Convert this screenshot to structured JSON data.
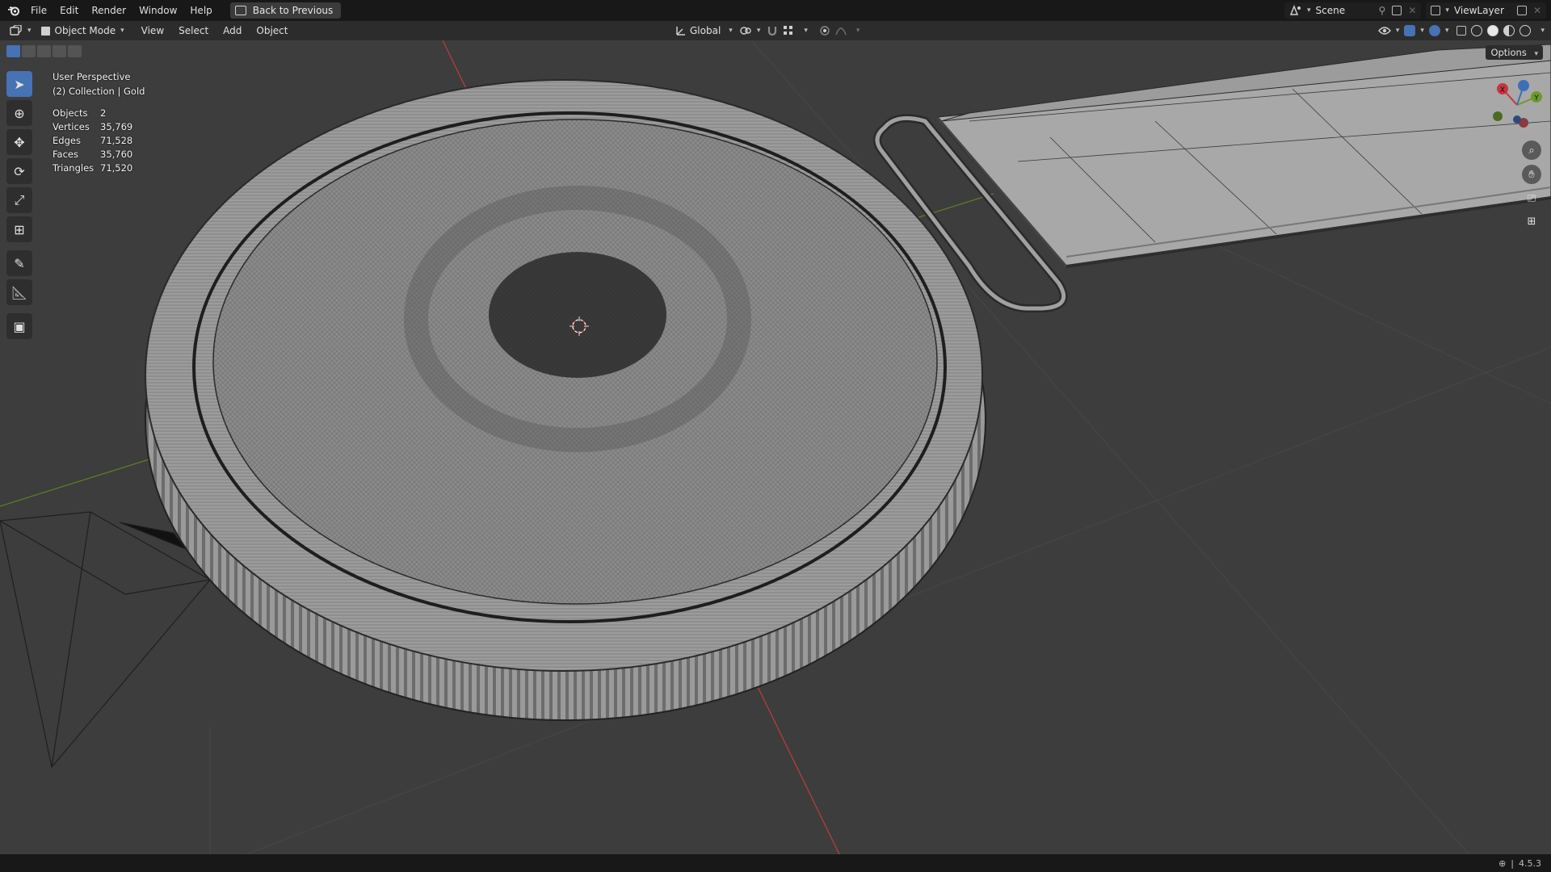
{
  "menu": {
    "items": [
      "File",
      "Edit",
      "Render",
      "Window",
      "Help"
    ],
    "back_button": "Back to Previous"
  },
  "workspace": {
    "scene_name": "Scene",
    "view_layer": "ViewLayer"
  },
  "header": {
    "mode": "Object Mode",
    "menus": [
      "View",
      "Select",
      "Add",
      "Object"
    ],
    "transform_orientation": "Global"
  },
  "viewport": {
    "perspective_label": "User Perspective",
    "collection_label": "(2) Collection | Gold",
    "options_label": "Options",
    "stats": [
      {
        "label": "Objects",
        "value": "2"
      },
      {
        "label": "Vertices",
        "value": "35,769"
      },
      {
        "label": "Edges",
        "value": "71,528"
      },
      {
        "label": "Faces",
        "value": "35,760"
      },
      {
        "label": "Triangles",
        "value": "71,520"
      }
    ],
    "gizmo_axes": [
      "X",
      "Y",
      "Z"
    ]
  },
  "toolbar": {
    "tools": [
      "select-box",
      "cursor",
      "move",
      "rotate",
      "scale",
      "transform",
      "annotate",
      "measure",
      "add-cube"
    ],
    "active": "select-box"
  },
  "status": {
    "version": "4.5.3"
  },
  "colors": {
    "accent": "#4772b3",
    "viewport_bg": "#3d3d3d",
    "axis_x": "#c8343f",
    "axis_y": "#6e9a2a"
  }
}
